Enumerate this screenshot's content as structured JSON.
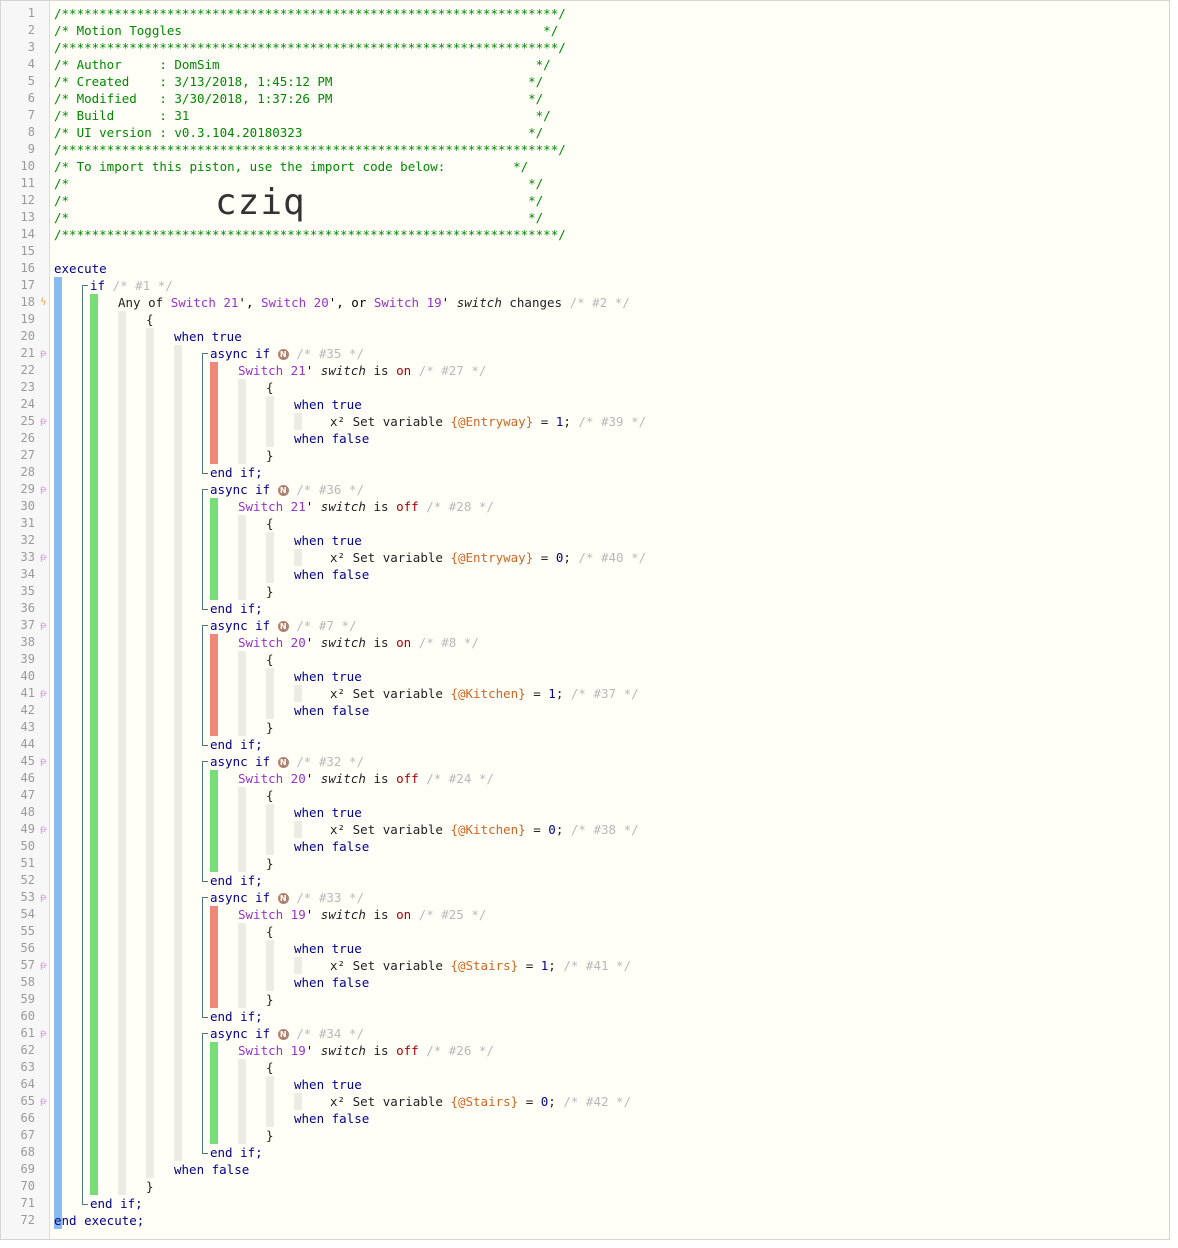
{
  "header": {
    "border": "/******************************************************************/",
    "title_line": "/* Motion Toggles                                                */",
    "author_line": "/* Author     : DomSim                                          */",
    "created_line": "/* Created    : 3/13/2018, 1:45:12 PM                          */",
    "modified_line": "/* Modified   : 3/30/2018, 1:37:26 PM                          */",
    "build_line": "/* Build      : 31                                              */",
    "ui_line": "/* UI version : v0.3.104.20180323                              */",
    "import_line": "/* To import this piston, use the import code below:         */",
    "blank_line": "/*                                                             */",
    "import_code": "cziq"
  },
  "keywords": {
    "execute": "execute",
    "end_execute": "end execute;",
    "if": "if",
    "async_if": "async if",
    "end_if": "end if;",
    "when_true": "when true",
    "when_false": "when false",
    "open_brace": "{",
    "close_brace": "}"
  },
  "trigger": {
    "prefix": "Any of",
    "dev1": "Switch 21",
    "dev2": "Switch 20",
    "dev3": "Switch 19",
    "attr": "switch",
    "op": "changes",
    "comment_if": "/* #1 */",
    "comment": "/* #2 */"
  },
  "blocks": [
    {
      "if_comment": "/* #35 */",
      "device": "Switch 21",
      "state": "on",
      "cond_comment": "/* #27 */",
      "var": "{@Entryway}",
      "value": "1",
      "action_comment": "/* #39 */",
      "bar": "red"
    },
    {
      "if_comment": "/* #36 */",
      "device": "Switch 21",
      "state": "off",
      "cond_comment": "/* #28 */",
      "var": "{@Entryway}",
      "value": "0",
      "action_comment": "/* #40 */",
      "bar": "green"
    },
    {
      "if_comment": "/* #7 */",
      "device": "Switch 20",
      "state": "on",
      "cond_comment": "/* #8 */",
      "var": "{@Kitchen}",
      "value": "1",
      "action_comment": "/* #37 */",
      "bar": "red"
    },
    {
      "if_comment": "/* #32 */",
      "device": "Switch 20",
      "state": "off",
      "cond_comment": "/* #24 */",
      "var": "{@Kitchen}",
      "value": "0",
      "action_comment": "/* #38 */",
      "bar": "green"
    },
    {
      "if_comment": "/* #33 */",
      "device": "Switch 19",
      "state": "on",
      "cond_comment": "/* #25 */",
      "var": "{@Stairs}",
      "value": "1",
      "action_comment": "/* #41 */",
      "bar": "red"
    },
    {
      "if_comment": "/* #34 */",
      "device": "Switch 19",
      "state": "off",
      "cond_comment": "/* #26 */",
      "var": "{@Stairs}",
      "value": "0",
      "action_comment": "/* #42 */",
      "bar": "green"
    }
  ],
  "labels": {
    "switch_attr": "switch",
    "is": "is",
    "set_variable": "Set variable",
    "equals": "=",
    "semicolon": ";",
    "x2_icon": "x²",
    "n_badge": "N"
  },
  "colors": {
    "comment_green": "#008800",
    "device_purple": "#9933cc",
    "keyword_blue": "#000088",
    "bar_blue": "#88bbf0",
    "bar_green": "#77dd77",
    "bar_red": "#f08878",
    "guide_gray": "#ecece4"
  },
  "icons": {
    "trigger": "bolt-icon",
    "action": "pi-icon"
  }
}
